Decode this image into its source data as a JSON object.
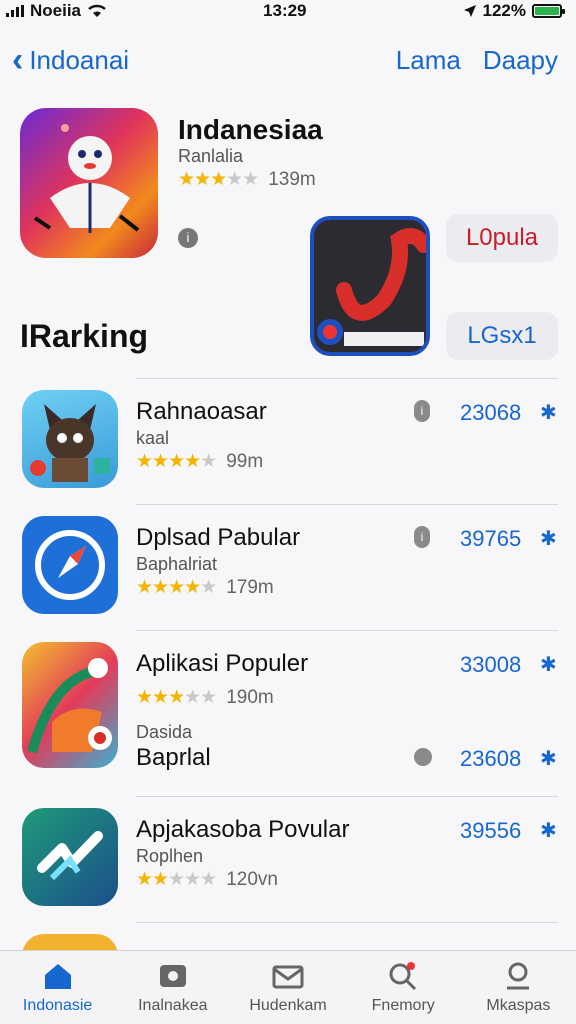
{
  "status": {
    "carrier": "Noeiia",
    "time": "13:29",
    "battery": "122%"
  },
  "nav": {
    "back_label": "Indoanai",
    "action1": "Lama",
    "action2": "Daapy"
  },
  "featured": {
    "title": "Indanesiaa",
    "subtitle": "Ranlalia",
    "rating_count": "139m",
    "promo_button_1": "L0pula",
    "promo_button_2": "LGsx1"
  },
  "section": {
    "title": "IRarking"
  },
  "apps": [
    {
      "name": "Rahnaoasar",
      "subtitle": "kaal",
      "rating_count": "99m",
      "price": "23068",
      "stars": 4.5
    },
    {
      "name": "Dplsad Pabular",
      "subtitle": "Baphalriat",
      "rating_count": "179m",
      "price": "39765",
      "stars": 4
    },
    {
      "name": "Aplikasi Populer",
      "subtitle": "",
      "rating_count": "190m",
      "price": "33008",
      "stars": 3.5,
      "extra_subtitle": "Dasida",
      "extra_name": "Baprlal",
      "extra_price": "23608"
    },
    {
      "name": "Apjakasoba Povular",
      "subtitle": "Roplhen",
      "rating_count": "120vn",
      "price": "39556",
      "stars": 2.5
    }
  ],
  "tabs": [
    {
      "label": "Indonasie",
      "active": true
    },
    {
      "label": "Inalnakea",
      "active": false
    },
    {
      "label": "Hudenkam",
      "active": false
    },
    {
      "label": "Fnemory",
      "active": false
    },
    {
      "label": "Mkaspas",
      "active": false
    }
  ],
  "colors": {
    "accent": "#1767d1",
    "star": "#f5b400",
    "red": "#c81e2a"
  }
}
